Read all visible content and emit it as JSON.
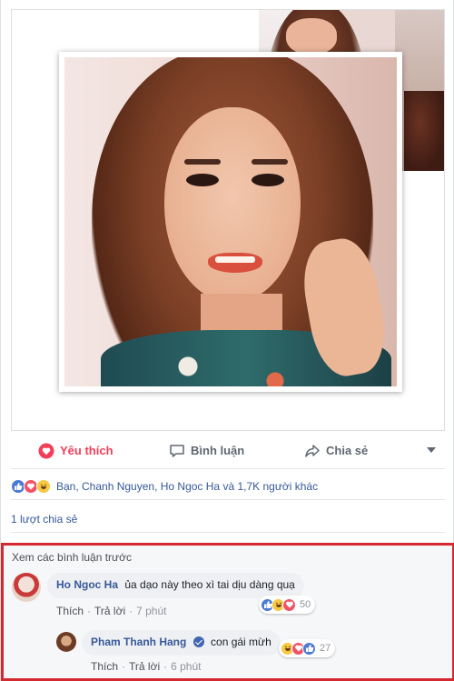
{
  "post": {
    "actions": {
      "like_label": "Yêu thích",
      "comment_label": "Bình luận",
      "share_label": "Chia sẻ"
    },
    "reactions_summary": "Bạn, Chanh Nguyen, Ho Ngoc Ha và 1,7K người khác",
    "shares_text": "1 lượt chia sẻ",
    "colors": {
      "love": "#f33e58",
      "link": "#365899",
      "highlight_border": "#d4292f"
    }
  },
  "comments": {
    "view_previous": "Xem các bình luận trước",
    "items": [
      {
        "name": "Ho Ngoc Ha",
        "text": "ủa dạo này theo xì tai dịu dàng quạ",
        "like_label": "Thích",
        "reply_label": "Trả lời",
        "time": "7 phút",
        "reaction_count": "50"
      },
      {
        "name": "Pham Thanh Hang",
        "text": "con gái mừh",
        "like_label": "Thích",
        "reply_label": "Trả lời",
        "time": "6 phút",
        "reaction_count": "27"
      }
    ]
  }
}
